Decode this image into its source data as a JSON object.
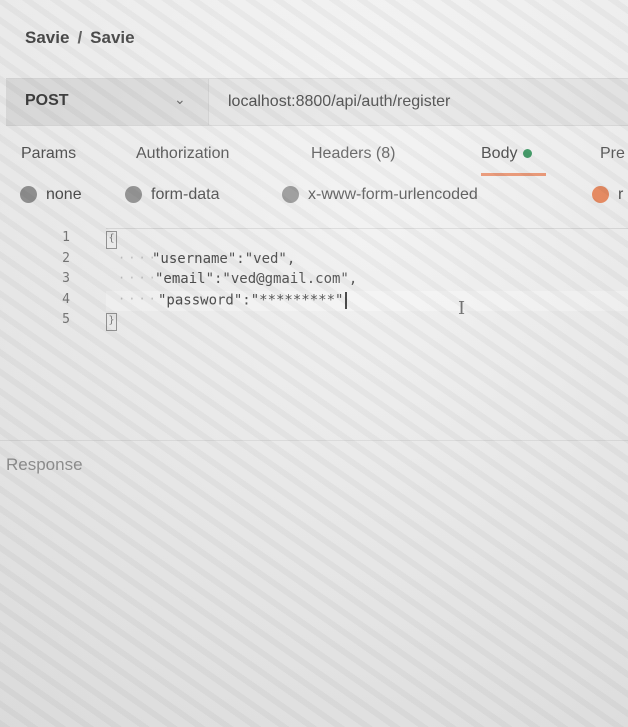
{
  "breadcrumb": {
    "collection": "Savie",
    "separator": "/",
    "request": "Savie"
  },
  "request": {
    "method": "POST",
    "url": "localhost:8800/api/auth/register"
  },
  "tabs": [
    {
      "label": "Params"
    },
    {
      "label": "Authorization"
    },
    {
      "label": "Headers (8)"
    },
    {
      "label": "Body"
    },
    {
      "label": "Pre"
    }
  ],
  "body_types": [
    {
      "label": "none"
    },
    {
      "label": "form-data"
    },
    {
      "label": "x-www-form-urlencoded"
    },
    {
      "label": "r"
    }
  ],
  "editor": {
    "lines": [
      {
        "number": "1",
        "code": ""
      },
      {
        "number": "2",
        "code": "\"username\":\"ved\","
      },
      {
        "number": "3",
        "code": "\"email\":\"ved@gmail.com\","
      },
      {
        "number": "4",
        "code": "\"password\":\"*********\""
      },
      {
        "number": "5",
        "code": ""
      }
    ]
  },
  "response": {
    "label": "Response"
  },
  "colors": {
    "accent": "#e8865e",
    "body_dot": "#1f8a4c"
  }
}
